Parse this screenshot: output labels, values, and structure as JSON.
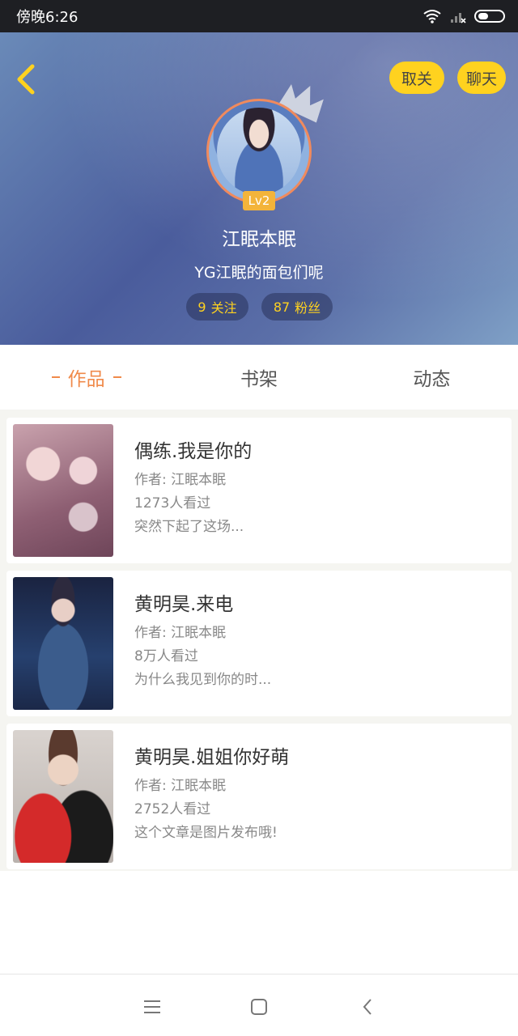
{
  "status_bar": {
    "time": "傍晚6:26",
    "icons": [
      "wifi-icon",
      "signal-icon",
      "battery-icon"
    ]
  },
  "header": {
    "back_icon": "chevron-left-icon",
    "unfollow_label": "取关",
    "chat_label": "聊天",
    "level": "Lv2",
    "username": "江眠本眠",
    "signature": "YG江眠的面包们呢",
    "stats": {
      "follow_count": "9",
      "follow_label": "关注",
      "fans_count": "87",
      "fans_label": "粉丝"
    },
    "accent_color": "#ffd21f"
  },
  "tabs": [
    {
      "label": "作品",
      "active": true
    },
    {
      "label": "书架",
      "active": false
    },
    {
      "label": "动态",
      "active": false
    }
  ],
  "works": [
    {
      "title": "偶练.我是你的",
      "author": "作者: 江眠本眠",
      "views": "1273人看过",
      "desc": "突然下起了这场..."
    },
    {
      "title": "黄明昊.来电",
      "author": "作者: 江眠本眠",
      "views": "8万人看过",
      "desc": "为什么我见到你的时..."
    },
    {
      "title": "黄明昊.姐姐你好萌",
      "author": "作者: 江眠本眠",
      "views": "2752人看过",
      "desc": "这个文章是图片发布哦!"
    }
  ],
  "nav_bar": {
    "icons": [
      "menu-icon",
      "home-square-icon",
      "back-arrow-icon"
    ]
  }
}
